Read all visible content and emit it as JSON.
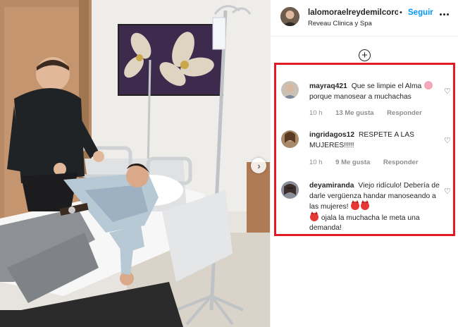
{
  "header": {
    "username": "lalomoraelreydemilcorona",
    "separator": "•",
    "follow_label": "Seguir",
    "location": "Reveau Clinica y Spa"
  },
  "comments": [
    {
      "username": "mayraq421",
      "text_before_emoji": "Que se limpie el Alma",
      "emoji": "pig-face-emoji",
      "text_after_emoji": "porque manosear a muchachas",
      "time": "10 h",
      "likes": "13 Me gusta",
      "reply": "Responder"
    },
    {
      "username": "ingridagos12",
      "text": "RESPETE A LAS MUJERES!!!!!",
      "time": "10 h",
      "likes": "9 Me gusta",
      "reply": "Responder"
    },
    {
      "username": "deyamiranda",
      "text_part1": "Viejo ridículo! Debería de darle vergüenza handar manoseando a las mujeres!",
      "emoji": "angry-devil-emoji",
      "text_part2": "ojala la muchacha le meta una demanda!"
    }
  ],
  "icons": {
    "next": "chevron-right-icon",
    "load_more": "plus-circle-icon",
    "more": "more-horizontal-icon",
    "like": "heart-outline-icon"
  },
  "colors": {
    "highlight": "#e01b24",
    "follow": "#0095f6",
    "meta": "#8e8e8e"
  }
}
